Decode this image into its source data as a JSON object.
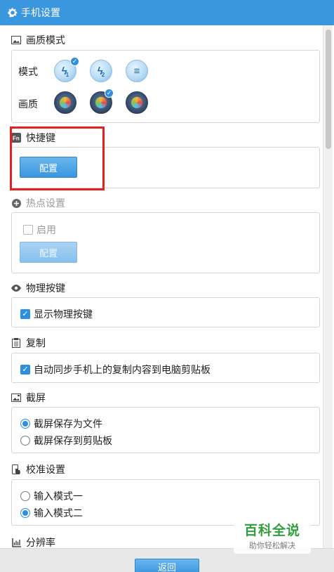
{
  "window": {
    "title": "手机设置",
    "icon": "gear-icon"
  },
  "sections": {
    "quality_mode": {
      "title": "画质模式",
      "icon": "image-icon",
      "mode_label": "模式",
      "mode_options": [
        {
          "name": "mode-1-icon",
          "glyph": "ϟ",
          "sub": "1",
          "selected": true
        },
        {
          "name": "mode-2-icon",
          "glyph": "ϟ",
          "sub": "2",
          "selected": false
        },
        {
          "name": "mode-3-icon",
          "glyph": "≡",
          "sub": "",
          "selected": false
        }
      ],
      "quality_label": "画质",
      "quality_options": [
        {
          "name": "quality-1-icon",
          "selected": false
        },
        {
          "name": "quality-2-icon",
          "selected": true
        },
        {
          "name": "quality-3-icon",
          "selected": false
        }
      ]
    },
    "shortcut": {
      "title": "快捷键",
      "icon": "fn-icon",
      "button": "配置"
    },
    "hotspot": {
      "title": "热点设置",
      "icon": "plus-circle-icon",
      "enable_label": "启用",
      "enabled": false,
      "button": "配置"
    },
    "physical_keys": {
      "title": "物理按键",
      "icon": "eye-icon",
      "show_label": "显示物理按键",
      "checked": true
    },
    "copy": {
      "title": "复制",
      "icon": "clipboard-icon",
      "sync_label": "自动同步手机上的复制内容到电脑剪贴板",
      "checked": true
    },
    "screenshot": {
      "title": "截屏",
      "icon": "screenshot-icon",
      "options": [
        "截屏保存为文件",
        "截屏保存到剪贴板"
      ],
      "selected_index": 0
    },
    "calibration": {
      "title": "校准设置",
      "icon": "touch-icon",
      "options": [
        "输入模式一",
        "输入模式二"
      ],
      "selected_index": 1
    },
    "resolution": {
      "title": "分辨率",
      "icon": "resolution-icon"
    }
  },
  "footer": {
    "back_button": "返回"
  },
  "watermark": {
    "title": "百科全说",
    "subtitle": "助你轻松解决"
  },
  "colors": {
    "accent": "#3a96dd",
    "highlight": "#e52020",
    "watermark": "#2f9e3f"
  }
}
